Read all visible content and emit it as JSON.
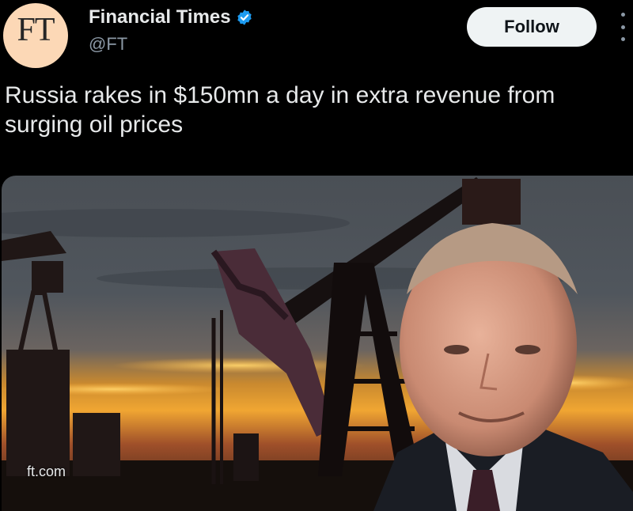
{
  "author": {
    "avatar_text": "FT",
    "display_name": "Financial Times",
    "handle": "@FT",
    "verified": true
  },
  "actions": {
    "follow_label": "Follow"
  },
  "tweet": {
    "text": "Russia rakes in $150mn a day in extra revenue from surging oil prices"
  },
  "media": {
    "domain": "ft.com",
    "description_icons": [
      "oil-pumpjack",
      "portrait"
    ]
  },
  "colors": {
    "background": "#000000",
    "verified_badge": "#1d9bf0",
    "follow_bg": "#eff3f4",
    "avatar_bg": "#fcd8b6"
  }
}
